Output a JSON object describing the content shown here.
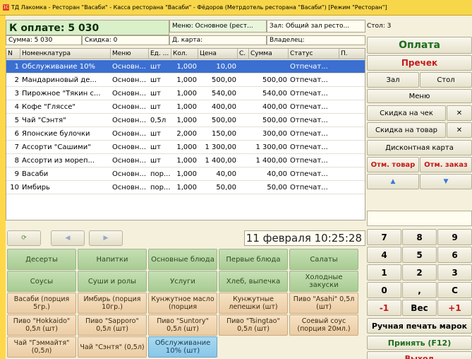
{
  "window": {
    "title": "ТД Лакомка - Ресторан \"Васаби\" - Касса ресторана \"Васаби\" - Фёдоров (Метрдотель ресторана \"Васаби\") [Режим \"Ресторан\"]",
    "icon_label": "1С"
  },
  "order": {
    "pay_label": "К оплате: 5 030",
    "menu_label": "Меню: Основное (рест...",
    "hall_label": "Зал: Общий зал ресто...",
    "table_label": "Стол: 3",
    "sum_label": "Сумма: 5 030",
    "discount_label": "Скидка: 0",
    "card_label": "Д. карта:",
    "owner_label": "Владелец:"
  },
  "grid": {
    "columns": [
      "N",
      "Номенклатура",
      "Меню",
      "Ед. ...",
      "Кол.",
      "Цена",
      "С.",
      "Сумма",
      "Статус",
      "П."
    ],
    "rows": [
      {
        "n": "1",
        "name": "Обслуживание 10%",
        "menu": "Основн...",
        "unit": "шт",
        "qty": "1,000",
        "price": "10,00",
        "s": "",
        "sum": "",
        "status": "Отпечат...",
        "p": ""
      },
      {
        "n": "2",
        "name": "Мандариновый де...",
        "menu": "Основн...",
        "unit": "шт",
        "qty": "1,000",
        "price": "500,00",
        "s": "",
        "sum": "500,00",
        "status": "Отпечат...",
        "p": ""
      },
      {
        "n": "3",
        "name": "Пирожное \"Тякин с...",
        "menu": "Основн...",
        "unit": "шт",
        "qty": "1,000",
        "price": "540,00",
        "s": "",
        "sum": "540,00",
        "status": "Отпечат...",
        "p": ""
      },
      {
        "n": "4",
        "name": "Кофе \"Гляссе\"",
        "menu": "Основн...",
        "unit": "шт",
        "qty": "1,000",
        "price": "400,00",
        "s": "",
        "sum": "400,00",
        "status": "Отпечат...",
        "p": ""
      },
      {
        "n": "5",
        "name": "Чай \"Сэнтя\"",
        "menu": "Основн...",
        "unit": "0,5л",
        "qty": "1,000",
        "price": "500,00",
        "s": "",
        "sum": "500,00",
        "status": "Отпечат...",
        "p": ""
      },
      {
        "n": "6",
        "name": "Японские булочки",
        "menu": "Основн...",
        "unit": "шт",
        "qty": "2,000",
        "price": "150,00",
        "s": "",
        "sum": "300,00",
        "status": "Отпечат...",
        "p": ""
      },
      {
        "n": "7",
        "name": "Ассорти \"Сашими\"",
        "menu": "Основн...",
        "unit": "шт",
        "qty": "1,000",
        "price": "1 300,00",
        "s": "",
        "sum": "1 300,00",
        "status": "Отпечат...",
        "p": ""
      },
      {
        "n": "8",
        "name": "Ассорти из мореп...",
        "menu": "Основн...",
        "unit": "шт",
        "qty": "1,000",
        "price": "1 400,00",
        "s": "",
        "sum": "1 400,00",
        "status": "Отпечат...",
        "p": ""
      },
      {
        "n": "9",
        "name": "Васаби",
        "menu": "Основн...",
        "unit": "пор...",
        "qty": "1,000",
        "price": "40,00",
        "s": "",
        "sum": "40,00",
        "status": "Отпечат...",
        "p": ""
      },
      {
        "n": "10",
        "name": "Имбирь",
        "menu": "Основн...",
        "unit": "пор...",
        "qty": "1,000",
        "price": "50,00",
        "s": "",
        "sum": "50,00",
        "status": "Отпечат...",
        "p": ""
      }
    ],
    "selected_row": 0
  },
  "nav": {
    "refresh_icon": "refresh-icon",
    "prev_icon": "arrow-left-icon",
    "next_icon": "arrow-right-icon",
    "datetime": "11 февраля 10:25:28"
  },
  "menu_buttons": [
    {
      "label": "Десерты",
      "kind": "cat"
    },
    {
      "label": "Напитки",
      "kind": "cat"
    },
    {
      "label": "Основные блюда",
      "kind": "cat"
    },
    {
      "label": "Первые блюда",
      "kind": "cat"
    },
    {
      "label": "Салаты",
      "kind": "cat"
    },
    {
      "label": "Соусы",
      "kind": "cat"
    },
    {
      "label": "Суши и ролы",
      "kind": "cat"
    },
    {
      "label": "Услуги",
      "kind": "cat"
    },
    {
      "label": "Хлеб, выпечка",
      "kind": "cat"
    },
    {
      "label": "Холодные закуски",
      "kind": "cat"
    },
    {
      "label": "Васаби (порция 5гр.)",
      "kind": "item"
    },
    {
      "label": "Имбирь (порция 10гр.)",
      "kind": "item"
    },
    {
      "label": "Кунжутное масло (порция",
      "kind": "item"
    },
    {
      "label": "Кунжутные лепешки (шт)",
      "kind": "item"
    },
    {
      "label": "Пиво \"Asahi\" 0,5л (шт)",
      "kind": "item"
    },
    {
      "label": "Пиво \"Hokkaido\" 0,5л (шт)",
      "kind": "item"
    },
    {
      "label": "Пиво \"Sapporo\" 0,5л (шт)",
      "kind": "item"
    },
    {
      "label": "Пиво \"Suntory\" 0,5л (шт)",
      "kind": "item"
    },
    {
      "label": "Пиво \"Tsingtao\" 0,5л (шт)",
      "kind": "item"
    },
    {
      "label": "Соевый соус (порция 20мл.)",
      "kind": "item"
    },
    {
      "label": "Чай \"Гэммайтя\" (0,5л)",
      "kind": "item"
    },
    {
      "label": "Чай \"Сэнтя\" (0,5л)",
      "kind": "item"
    },
    {
      "label": "Обслуживание 10% (шт)",
      "kind": "active"
    }
  ],
  "right": {
    "pay": "Оплата",
    "precheck": "Пречек",
    "hall": "Зал",
    "table": "Стол",
    "menu": "Меню",
    "check_discount": "Скидка на чек",
    "item_discount": "Скидка на товар",
    "clear_x": "✕",
    "discount_card": "Дисконтная карта",
    "cancel_item": "Отм. товар",
    "cancel_order": "Отм. заказ",
    "up_icon": "arrow-up-icon",
    "down_icon": "arrow-down-icon",
    "keys": [
      "7",
      "8",
      "9",
      "4",
      "5",
      "6",
      "1",
      "2",
      "3",
      "0",
      ",",
      "C",
      "-1",
      "Вес",
      "+1"
    ],
    "manual_print": "Ручная печать марок",
    "accept": "Принять (F12)",
    "exit": "Выход"
  },
  "colors": {
    "accent_green": "#1c6e1c",
    "accent_red": "#c41a1a",
    "selection": "#3b6fd0",
    "frame": "#ffd84a"
  }
}
